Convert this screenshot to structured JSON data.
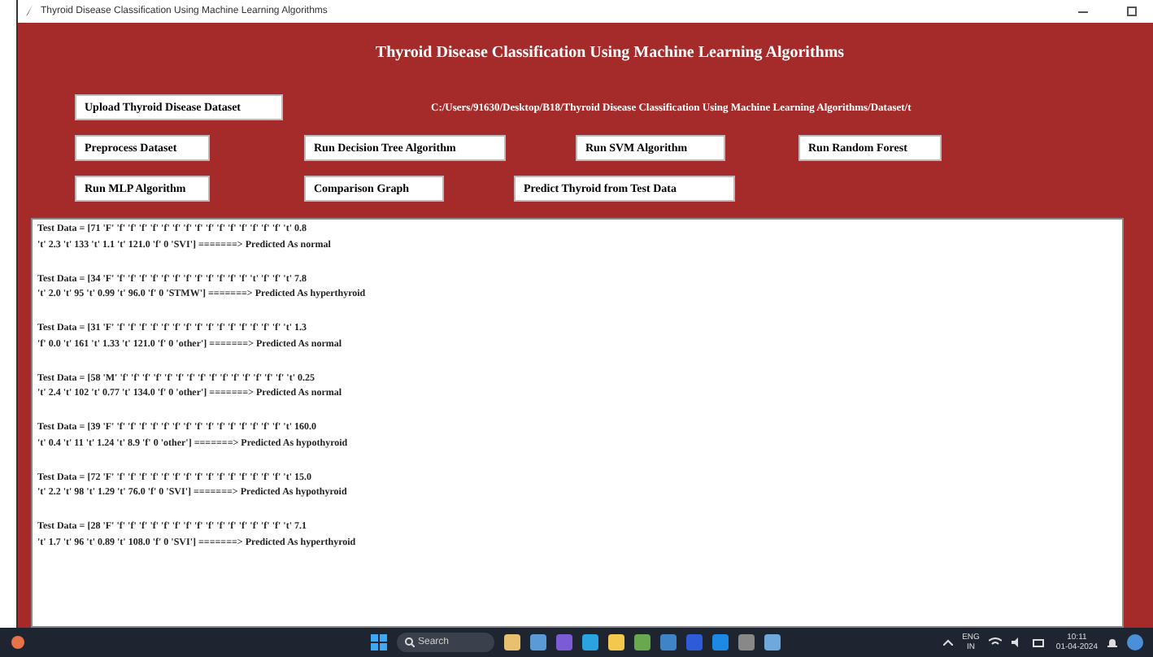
{
  "window": {
    "title": "Thyroid Disease Classification Using Machine Learning Algorithms"
  },
  "heading": "Thyroid Disease Classification Using Machine Learning Algorithms",
  "button_rows": [
    {
      "buttons": [
        "Upload Thyroid Disease Dataset"
      ],
      "path": "C:/Users/91630/Desktop/B18/Thyroid Disease Classification Using Machine Learning Algorithms/Dataset/t"
    },
    {
      "buttons": [
        "Preprocess Dataset",
        "Run Decision Tree Algorithm",
        "Run SVM Algorithm",
        "Run Random Forest"
      ]
    },
    {
      "buttons": [
        "Run MLP Algorithm",
        "Comparison Graph",
        "Predict Thyroid from Test Data"
      ]
    }
  ],
  "output_lines": [
    "Test Data = [71 'F' 'f' 'f' 'f' 'f' 'f' 'f' 'f' 'f' 'f' 'f' 'f' 'f' 'f' 'f' 'f' 't' 0.8\n't' 2.3 't' 133 't' 1.1 't' 121.0 'f' 0 'SVI'] =======> Predicted As normal",
    "Test Data = [34 'F' 'f' 'f' 'f' 'f' 'f' 'f' 'f' 'f' 'f' 'f' 'f' 'f' 't' 'f' 'f' 't' 7.8\n't' 2.0 't' 95 't' 0.99 't' 96.0 'f' 0 'STMW'] =======> Predicted As hyperthyroid",
    "Test Data = [31 'F' 'f' 'f' 'f' 'f' 'f' 'f' 'f' 'f' 'f' 'f' 'f' 'f' 'f' 'f' 'f' 't' 1.3\n'f' 0.0 't' 161 't' 1.33 't' 121.0 'f' 0 'other'] =======> Predicted As normal",
    "Test Data = [58 'M' 'f' 'f' 'f' 'f' 'f' 'f' 'f' 'f' 'f' 'f' 'f' 'f' 'f' 'f' 'f' 't' 0.25\n't' 2.4 't' 102 't' 0.77 't' 134.0 'f' 0 'other'] =======> Predicted As normal",
    "Test Data = [39 'F' 'f' 'f' 'f' 'f' 'f' 'f' 'f' 'f' 'f' 'f' 'f' 'f' 'f' 'f' 'f' 't' 160.0\n't' 0.4 't' 11 't' 1.24 't' 8.9 'f' 0 'other'] =======> Predicted As hypothyroid",
    "Test Data = [72 'F' 'f' 'f' 'f' 'f' 'f' 'f' 'f' 'f' 'f' 'f' 'f' 'f' 'f' 'f' 'f' 't' 15.0\n't' 2.2 't' 98 't' 1.29 't' 76.0 'f' 0 'SVI'] =======> Predicted As hypothyroid",
    "Test Data = [28 'F' 'f' 'f' 'f' 'f' 'f' 'f' 'f' 'f' 'f' 'f' 'f' 'f' 'f' 'f' 'f' 't' 7.1\n't' 1.7 't' 96 't' 0.89 't' 108.0 'f' 0 'SVI'] =======> Predicted As hyperthyroid"
  ],
  "taskbar": {
    "search_placeholder": "Search",
    "language": "ENG\nIN",
    "time": "10:11",
    "date": "01-04-2024"
  }
}
